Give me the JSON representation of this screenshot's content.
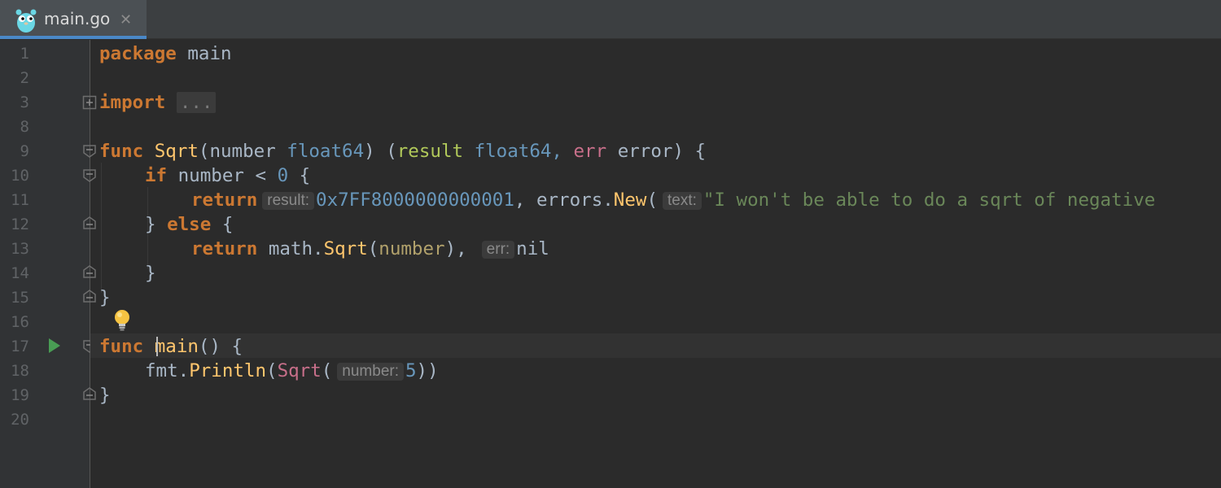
{
  "tab": {
    "filename": "main.go",
    "close_glyph": "✕",
    "icon": "gopher-icon"
  },
  "gutter": {
    "line_numbers": [
      "1",
      "2",
      "3",
      "8",
      "9",
      "10",
      "11",
      "12",
      "13",
      "14",
      "15",
      "16",
      "17",
      "18",
      "19",
      "20"
    ],
    "run_icon": "run-icon"
  },
  "code": {
    "l1": {
      "kw": "package",
      "name": "main"
    },
    "l3": {
      "kw": "import",
      "folded": "..."
    },
    "l9": {
      "kw": "func",
      "name": "Sqrt",
      "open": "(",
      "param": "number",
      "ptype": "float64",
      "mid": ") (",
      "res": "result",
      "rtype": "float64,",
      "err": "err",
      "etype": "error",
      "close": ") {"
    },
    "l10": {
      "kw": "if",
      "cond_var": "number",
      "op": " < ",
      "num": "0",
      "brace": " {"
    },
    "l11": {
      "kw": "return",
      "hint": "result:",
      "value": "0x7FF8000000000001",
      "comma": ", ",
      "pkg": "errors.",
      "fn": "New",
      "paren": "(",
      "hint2": "text:",
      "str": "\"I won't be able to do a sqrt of negative"
    },
    "l12": {
      "close": "} ",
      "kw": "else",
      "brace": " {"
    },
    "l13": {
      "kw": "return",
      "pkg": "math.",
      "fn": "Sqrt",
      "open": "(",
      "arg": "number",
      "close": "),",
      "hint": "err:",
      "nil": "nil"
    },
    "l14": {
      "brace": "}"
    },
    "l15": {
      "brace": "}"
    },
    "l17": {
      "kw": "func",
      "name": "main",
      "rest": "() {"
    },
    "l18": {
      "pkg": "fmt.",
      "fn": "Println",
      "open": "(",
      "call": "Sqrt",
      "open2": "(",
      "hint": "number:",
      "num": "5",
      "close": "))"
    },
    "l19": {
      "brace": "}"
    }
  },
  "colors": {
    "background": "#2b2b2b",
    "gutter": "#313335",
    "keyword": "#cc7832",
    "function": "#ffc66d",
    "number": "#6897bb",
    "string": "#6a8759",
    "tab_accent": "#4a88c7",
    "run": "#499c54"
  },
  "icons": {
    "bulb": "lightbulb-icon",
    "fold": "fold-marker-icon"
  }
}
